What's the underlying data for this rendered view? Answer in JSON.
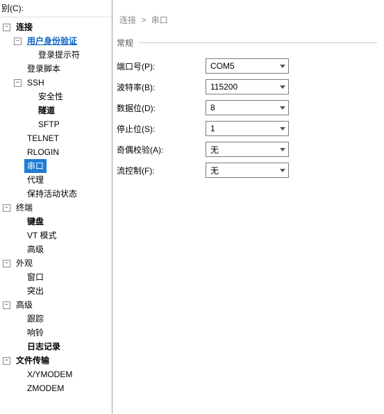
{
  "category_label": "别(C):",
  "breadcrumb": {
    "root": "连接",
    "sep": ">",
    "current": "串口"
  },
  "section_title": "常规",
  "tree": {
    "connection": {
      "label": "连接",
      "auth": {
        "label": "用户身份验证",
        "prompt": "登录提示符"
      },
      "login_script": "登录脚本",
      "ssh": {
        "label": "SSH",
        "security": "安全性",
        "tunnel": "隧道",
        "sftp": "SFTP"
      },
      "telnet": "TELNET",
      "rlogin": "RLOGIN",
      "serial": "串口",
      "proxy": "代理",
      "keepalive": "保持活动状态"
    },
    "terminal": {
      "label": "终端",
      "keyboard": "键盘",
      "vt_mode": "VT 模式",
      "advanced": "高级"
    },
    "appearance": {
      "label": "外观",
      "window": "窗口",
      "highlight": "突出"
    },
    "advanced": {
      "label": "高级",
      "trace": "跟踪",
      "bell": "响铃",
      "logging": "日志记录"
    },
    "file_transfer": {
      "label": "文件传输",
      "xymodem": "X/YMODEM",
      "zmodem": "ZMODEM"
    }
  },
  "form": {
    "port": {
      "label": "端口号(P):",
      "value": "COM5"
    },
    "baud": {
      "label": "波特率(B):",
      "value": "115200"
    },
    "databits": {
      "label": "数据位(D):",
      "value": "8"
    },
    "stopbits": {
      "label": "停止位(S):",
      "value": "1"
    },
    "parity": {
      "label": "奇偶校验(A):",
      "value": "无"
    },
    "flowctl": {
      "label": "流控制(F):",
      "value": "无"
    }
  }
}
